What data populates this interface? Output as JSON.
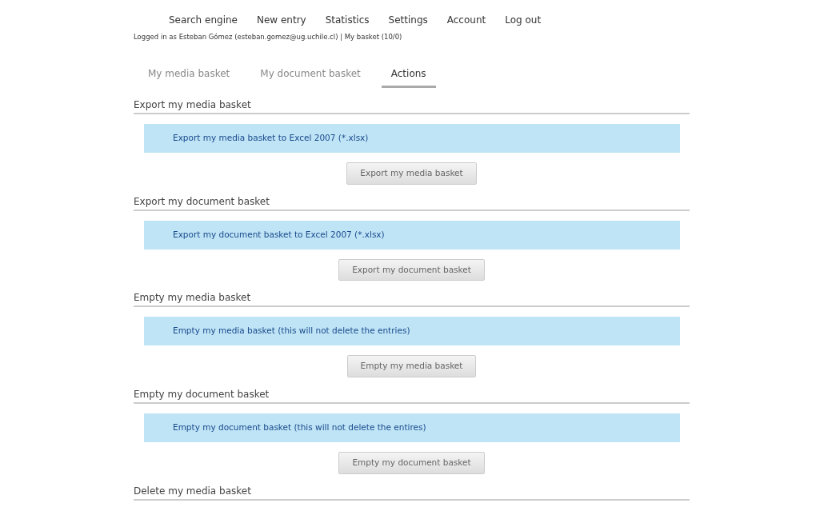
{
  "nav": [
    "Search engine",
    "New entry",
    "Statistics",
    "Settings",
    "Account",
    "Log out"
  ],
  "login_line": "Logged in as Esteban Gómez (esteban.gomez@ug.uchile.cl) | My basket (10/0)",
  "tabs": [
    {
      "label": "My media basket",
      "selected": false
    },
    {
      "label": "My document basket",
      "selected": false
    },
    {
      "label": "Actions",
      "selected": true
    }
  ],
  "sections": [
    {
      "title": "Export my media basket",
      "info": "Export my media basket to Excel 2007 (*.xlsx)",
      "button": "Export my media basket"
    },
    {
      "title": "Export my document basket",
      "info": "Export my document basket to Excel 2007 (*.xlsx)",
      "button": "Export my document basket"
    },
    {
      "title": "Empty my media basket",
      "info": "Empty my media basket (this will not delete the entries)",
      "button": "Empty my media basket"
    },
    {
      "title": "Empty my document basket",
      "info": "Empty my document basket (this will not delete the entires)",
      "button": "Empty my document basket"
    },
    {
      "title": "Delete my media basket"
    }
  ]
}
